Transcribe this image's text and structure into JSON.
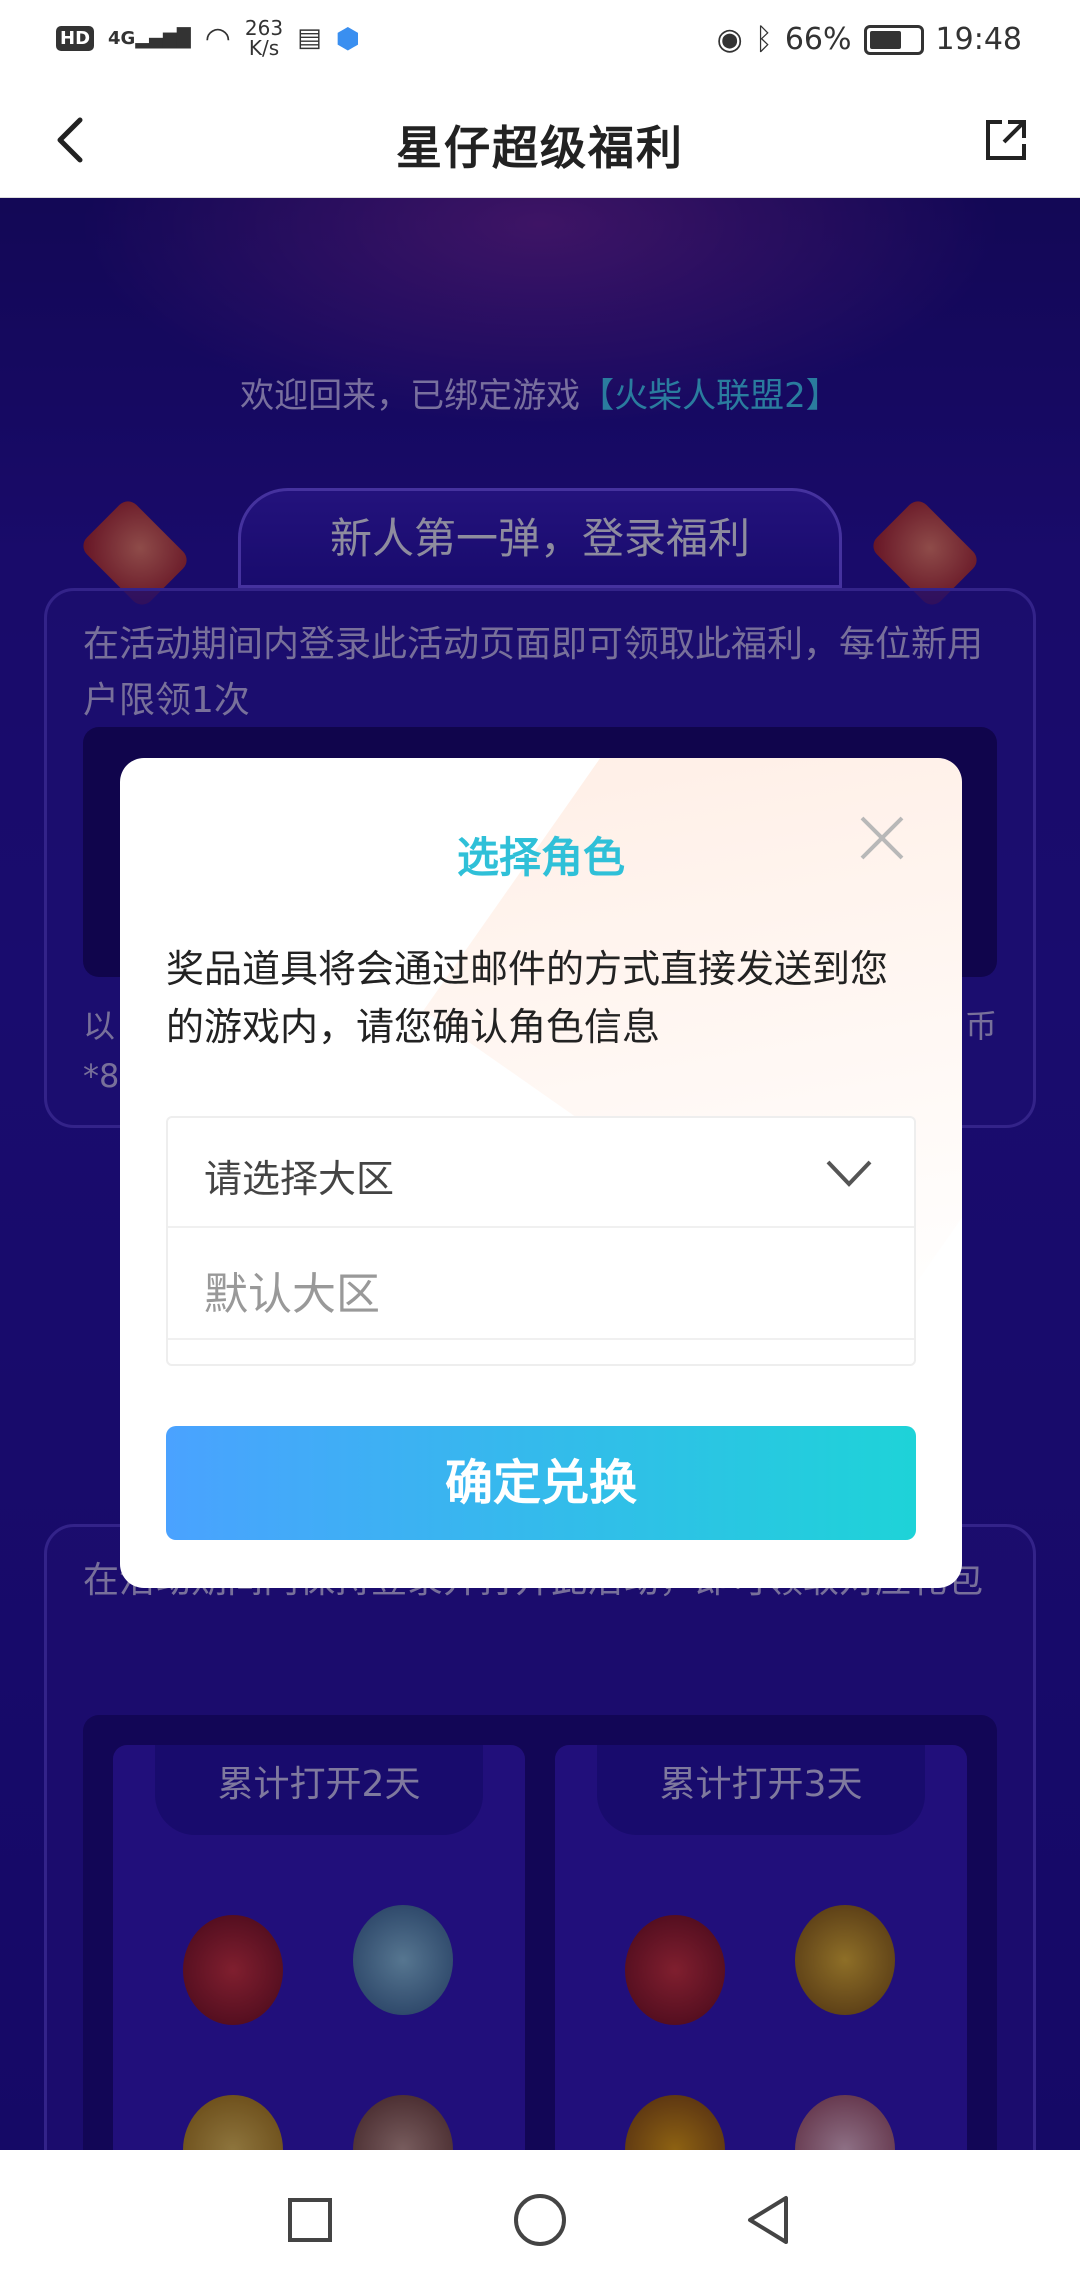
{
  "status_bar": {
    "hd": "HD",
    "signal": "4G",
    "net_speed_value": "263",
    "net_speed_unit": "K/s",
    "battery": "66%",
    "battery_level": 0.66,
    "time": "19:48"
  },
  "header": {
    "title": "星仔超级福利"
  },
  "page": {
    "welcome_prefix": "欢迎回来，已绑定游戏",
    "welcome_game": "【火柴人联盟2】",
    "section1_title": "新人第一弹，登录福利",
    "section1_desc": "在活动期间内登录此活动页面即可领取此福利，每位新用户限领1次",
    "section1_partial_left": "以",
    "section1_partial_right": "币",
    "section1_partial_left2": "*8",
    "section2_desc": "在活动期间内保持登录并打开此活动，即可领取对应礼包",
    "reward_tabs": [
      "累计打开2天",
      "累计打开3天"
    ]
  },
  "dialog": {
    "title": "选择角色",
    "description": "奖品道具将会通过邮件的方式直接发送到您的游戏内，请您确认角色信息",
    "select_placeholder": "请选择大区",
    "options": [
      "默认大区"
    ],
    "confirm_label": "确定兑换"
  },
  "colors": {
    "accent_title": "#2fc0d8",
    "button_gradient_start": "#4aa2ff",
    "button_gradient_end": "#1ed3d8",
    "page_bg": "#2b16a8",
    "game_name": "#49e2ff"
  },
  "icons": {
    "back": "chevron-left-icon",
    "share": "external-link-icon",
    "close": "close-icon",
    "dropdown": "chevron-down-icon",
    "nav_recent": "square-icon",
    "nav_home": "circle-icon",
    "nav_back": "triangle-icon"
  }
}
